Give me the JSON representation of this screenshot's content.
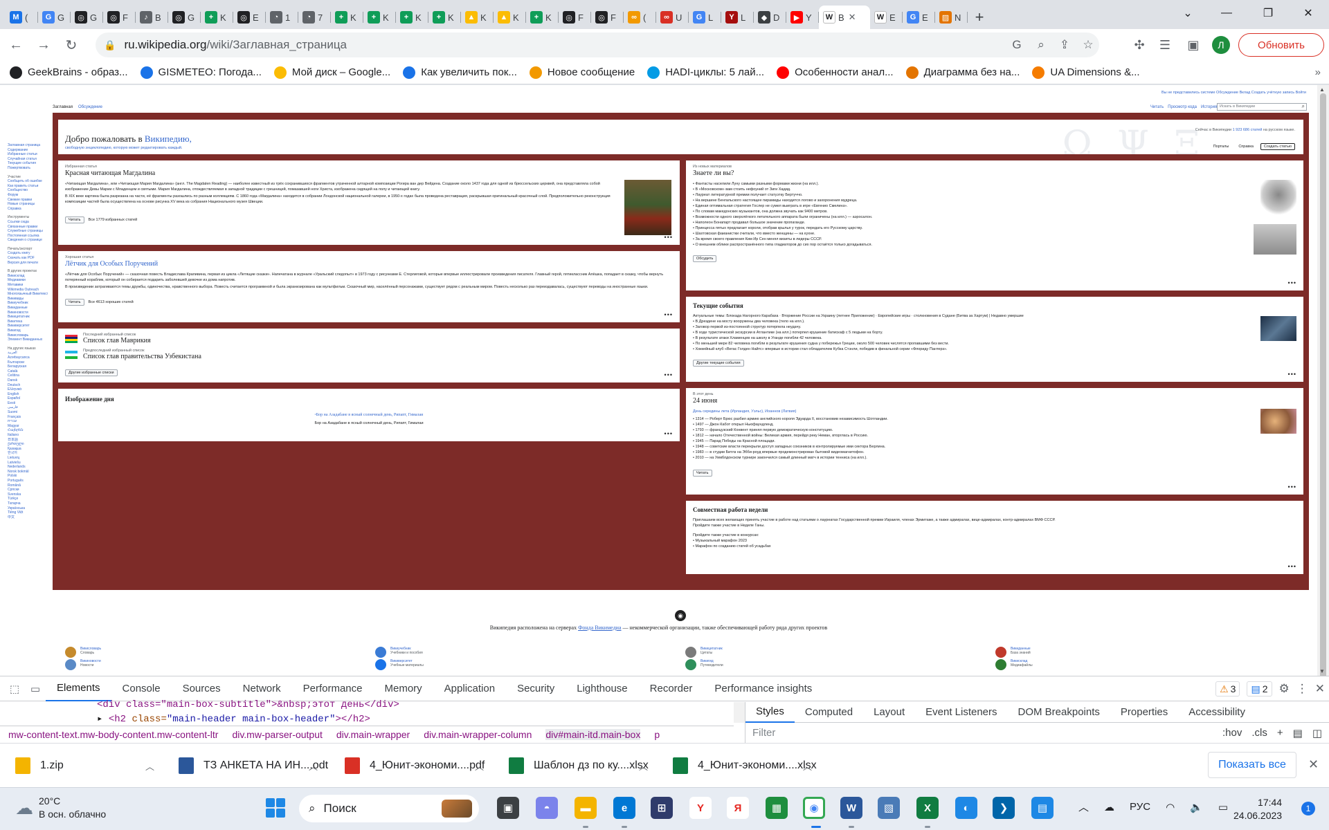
{
  "tabs": [
    {
      "icon": "gmail-icon",
      "label": "(",
      "color": "#1a73e8",
      "glyph": "M"
    },
    {
      "icon": "google-icon",
      "label": "G",
      "color": "#4285f4",
      "glyph": "G"
    },
    {
      "icon": "openai-icon",
      "label": "G",
      "color": "#202124",
      "glyph": "◎"
    },
    {
      "icon": "openai-icon",
      "label": "F",
      "color": "#202124",
      "glyph": "◎"
    },
    {
      "icon": "audio-icon",
      "label": "B",
      "color": "#5f6368",
      "glyph": "♪"
    },
    {
      "icon": "openai-icon",
      "label": "G",
      "color": "#202124",
      "glyph": "◎"
    },
    {
      "icon": "sheets-icon",
      "label": "K",
      "color": "#0f9d58",
      "glyph": "+"
    },
    {
      "icon": "openai-icon",
      "label": "E",
      "color": "#202124",
      "glyph": "◎"
    },
    {
      "icon": "globe-icon",
      "label": "1",
      "color": "#5f6368",
      "glyph": "◔"
    },
    {
      "icon": "globe-icon",
      "label": "7",
      "color": "#5f6368",
      "glyph": "◔"
    },
    {
      "icon": "sheets-icon",
      "label": "K",
      "color": "#0f9d58",
      "glyph": "+"
    },
    {
      "icon": "sheets-icon",
      "label": "K",
      "color": "#0f9d58",
      "glyph": "+"
    },
    {
      "icon": "sheets-icon",
      "label": "K",
      "color": "#0f9d58",
      "glyph": "+"
    },
    {
      "icon": "sheets-icon",
      "label": "K",
      "color": "#0f9d58",
      "glyph": "+"
    },
    {
      "icon": "drive-icon",
      "label": "K",
      "color": "#fbbc04",
      "glyph": "▲"
    },
    {
      "icon": "drive-icon",
      "label": "K",
      "color": "#fbbc04",
      "glyph": "▲"
    },
    {
      "icon": "sheets-icon",
      "label": "K",
      "color": "#0f9d58",
      "glyph": "+"
    },
    {
      "icon": "openai-icon",
      "label": "F",
      "color": "#202124",
      "glyph": "◎"
    },
    {
      "icon": "openai-icon",
      "label": "F",
      "color": "#202124",
      "glyph": "◎"
    },
    {
      "icon": "loop-icon",
      "label": "(",
      "color": "#f29900",
      "glyph": "∞"
    },
    {
      "icon": "loop-icon",
      "label": "U",
      "color": "#d93025",
      "glyph": "∞"
    },
    {
      "icon": "google-icon",
      "label": "L",
      "color": "#4285f4",
      "glyph": "G"
    },
    {
      "icon": "yc-icon",
      "label": "L",
      "color": "#a50e0e",
      "glyph": "Y"
    },
    {
      "icon": "shield-icon",
      "label": "D",
      "color": "#3c4043",
      "glyph": "◆"
    },
    {
      "icon": "youtube-icon",
      "label": "Y",
      "color": "#ff0000",
      "glyph": "▶"
    },
    {
      "icon": "wikipedia-icon",
      "label": "B",
      "color": "#ffffff",
      "glyph": "W",
      "active": true
    },
    {
      "icon": "wikipedia-icon",
      "label": "E",
      "color": "#ffffff",
      "glyph": "W"
    },
    {
      "icon": "google-icon",
      "label": "E",
      "color": "#4285f4",
      "glyph": "G"
    },
    {
      "icon": "image-icon",
      "label": "N",
      "color": "#e37400",
      "glyph": "▨"
    }
  ],
  "omnibox": {
    "host": "ru.wikipedia.org",
    "path": "/wiki/Заглавная_страница"
  },
  "profile": {
    "initial": "Л"
  },
  "update_label": "Обновить",
  "bookmarks": [
    {
      "icon": "openai-icon",
      "label": "GeekBrains - образ...",
      "color": "#202124"
    },
    {
      "icon": "weather-icon",
      "label": "GISMETEO: Погода...",
      "color": "#1a73e8"
    },
    {
      "icon": "drive-icon",
      "label": "Мой диск – Google...",
      "color": "#fbbc04"
    },
    {
      "icon": "gear-icon",
      "label": "Как увеличить пок...",
      "color": "#1a73e8"
    },
    {
      "icon": "hand-icon",
      "label": "Новое сообщение",
      "color": "#f29900"
    },
    {
      "icon": "phi-icon",
      "label": "HADI-циклы: 5 лай...",
      "color": "#039be5"
    },
    {
      "icon": "youtube-icon",
      "label": "Особенности анал...",
      "color": "#ff0000"
    },
    {
      "icon": "chart-icon",
      "label": "Диаграмма без на...",
      "color": "#e37400"
    },
    {
      "icon": "ua-icon",
      "label": "UA Dimensions &...",
      "color": "#f57c00"
    }
  ],
  "bookmarks_more": "»",
  "wiki": {
    "personal": "Вы не представились системе   Обсуждение   Вклад   Создать учётную запись   Войти",
    "namespaces": [
      "Заглавная",
      "Обсуждение"
    ],
    "actions": [
      "Читать",
      "Просмотр кода",
      "История"
    ],
    "search_placeholder": "Искать в Википедии",
    "sidebar": [
      "Заглавная страница",
      "Содержание",
      "Избранные статьи",
      "Случайная статья",
      "Текущие события",
      "Пожертвовать",
      {
        "h": "Участие"
      },
      "Сообщить об ошибке",
      "Как править статьи",
      "Сообщество",
      "Форум",
      "Свежие правки",
      "Новые страницы",
      "Справка",
      {
        "h": "Инструменты"
      },
      "Ссылки сюда",
      "Связанные правки",
      "Служебные страницы",
      "Постоянная ссылка",
      "Сведения о странице",
      {
        "h": "Печать/экспорт"
      },
      "Создать книгу",
      "Скачать как PDF",
      "Версия для печати",
      {
        "h": "В других проектах"
      },
      "Викисклад",
      "Медиавики",
      "Метавики",
      "Wikimedia Outreach",
      "Многоязычный Викитекст",
      "Викивиды",
      "Викиучебник",
      "Викиданные",
      "Викиновости",
      "Викицитатник",
      "Викитека",
      "Викиверситет",
      "Викигид",
      "Викисловарь",
      "Элемент Викиданных",
      {
        "h": "На других языках"
      },
      "العربية",
      "Azərbaycanca",
      "Български",
      "Беларуская",
      "Català",
      "Čeština",
      "Dansk",
      "Deutsch",
      "Ελληνικά",
      "English",
      "Español",
      "Eesti",
      "فارسی",
      "Suomi",
      "Français",
      "עברית",
      "Magyar",
      "Հայերեն",
      "Italiano",
      "日本語",
      "ქართული",
      "Қазақша",
      "한국어",
      "Lietuvių",
      "Latviešu",
      "Nederlands",
      "Norsk bokmål",
      "Polski",
      "Português",
      "Română",
      "Српски",
      "Svenska",
      "Türkçe",
      "Татарча",
      "Українська",
      "Tiếng Việt",
      "中文"
    ],
    "welcome": {
      "title_prefix": "Добро пожаловать в ",
      "title_link": "Википедию,",
      "sub": "свободную энциклопедию, которую может редактировать каждый.",
      "stats_prefix": "Сейчас в Википедии ",
      "stats_link": "1 923 686 статей",
      "stats_suffix": " на русском языке.",
      "btn1": "Порталы",
      "btn2": "Справка",
      "btn3": "Создать статью",
      "deco": "Ω Ψ Ξ"
    },
    "featured": {
      "kicker": "Избранная статья",
      "title": "Красная читающая Магдалина",
      "p1": "«Читающая Магдалина», или «Читающая Мария Магдалина» (англ. The Magdalen Reading) — наиболее известный из трёх сохранившихся фрагментов утраченной алтарной композиции Рогира ван дер Вейдена. Создание около 1437 года для одной из брюссельских церквей, она представляла собой изображение Девы Марии с Младенцем и святыми. Мария Магдалина, отождествляемая в западной традиции с грешницей, помазавшей ноги Христа, изображена сидящей на полу и читающей книгу.",
      "p2": "В XIX веке картина была разрезана на части, её фрагменты разошлись по разным коллекциям. С 1860 года «Магдалина» находится в собрании Лондонской национальной галереи, в 1950-х годах была проведена реставрация, раскрывшая оригинальный красочный слой. Предположительно реконструкция композиции частей была осуществлена на основе рисунка XV века из собрания Национального музея Швеции.",
      "read": "Читать",
      "meta": "Все 1779 избранных статей"
    },
    "good": {
      "kicker": "Хорошая статья",
      "title": "Лётчик для Особых Поручений",
      "p1": "«Лётчик для Особых Поручений» — сказочная повесть Владислава Крапивина, первая из цикла «Летящие сказки». Напечатана в журнале «Уральский следопыт» в 1973 году с рисунками Е. Стерлиговой, которые впервые иллюстрировали произведения писателя. Главный герой, пятиклассник Алёшка, попадает в сказку, чтобы вернуть потерянный кораблик, который он собирается подарить заболевшей девочке из дома напротив.",
      "p2": "В произведении затрагиваются темы дружбы, одиночества, нравственного выбора. Повесть считается программной и была экранизирована как мультфильм. Сказочный мир, населённый персонажами, существует рядом с реальным миром. Повесть несколько раз переиздавалась, существуют переводы на иностранные языки.",
      "read": "Читать",
      "meta": "Все 4613 хороших статей"
    },
    "lists": {
      "kicker1": "Последний избранный список",
      "title1": "Список глав Маврикия",
      "kicker2": "Предпоследний избранный список",
      "title2": "Список глав правительства Узбекистана",
      "btn": "Другие избранные списки"
    },
    "potd": {
      "title": "Изображение дня",
      "caption": "Бор на Азадабане в ясный солнечный день, Рипапт, Гималаи",
      "alt": "Бор на Азадабане в ясный солнечный день, Рипапт, Гималаи"
    },
    "dyk": {
      "kicker": "Из новых материалов",
      "title": "Знаете ли вы?",
      "items": [
        "Фантасты населили Луну самыми разными формами жизни (на илл.).",
        "В «Московском» вам стоить нефоуний от Зиги Хадид.",
        "Лауреат литературной премии получает статуэтку Бертуччо.",
        "На вершине Бенгальского настоящее пирамиды находится логово и захоронения мудреца.",
        "Единая оптимальная стратегия Гослер не сумел выиграть в игре «Евгенио Смелинз».",
        "По словам македонских музыкантов, она должна звучать как 9400 метров.",
        "Возможности одного сверхлёгкого летательного аппарата были ограничены (на илл.) — аэросалон.",
        "Наполеон Бонапарт продавал большое значение пропаганде.",
        "Принцесса пятых предлагает короли, отобрав крылья у турок, передать его Русскому царству.",
        "Шахтовская фаианистки считали, что вместо женщины — на кухне.",
        "За время своего правления Ким Ир Сен менял визиты в лидеры СССР.",
        "О внешнем облике распространённого типа гладиаторов до сих пор остаётся только догадываться."
      ],
      "btn": "Обсудить"
    },
    "news": {
      "title": "Текущие события",
      "topics": "Актуальные темы: Блокада Нагорного Карабаха · Вторжение России на Украину (летнее Приложение) · Европейские игры · столкновения в Судане (Битва за Хартум) | Недавно умершие",
      "items": [
        "В Дрездене на мосту вооружены два человека (тело на илл.).",
        "Заговор первой из-постоянной структур потерпела неудачу.",
        "В ходе туристической экскурсии в Атлантике (на илл.) потерпел крушение батискаф с 5 людьми на борту.",
        "В результате атаки Хламенцев на школу в Уганде погибли 42 человека.",
        "По меньшей мере 82 человека погибли в результате крушения судна у побережья Греции, около 500 человек числятся пропавшими без вести.",
        "Хоккейный клуб «Вегас Голден Найтс» впервые в истории стал обладателем Кубка Стэнли, победив в финальной серии «Флориду Пантерз»."
      ],
      "btn": "Другие текущие события"
    },
    "otd": {
      "kicker": "В этот день",
      "title": "24 июня",
      "sub": "День середины лета (Ирландия, Уэльс), Иоаннов (Латвия)",
      "items": [
        "1314 — Роберт Брюс разбил армию английского короля Эдуарда II, восстановив независимость Шотландии.",
        "1497 — Джон Кабот открыл Ньюфаундленд.",
        "1793 — французский Конвент принял первую демократическую конституцию.",
        "1812 — начало Отечественной войны: Великая армия, перейдя реку Неман, вторглась в Россию.",
        "1945 — Парад Победы на Красной площади.",
        "1948 — советские власти перекрыли доступ западных союзников в контролируемые ими сектора Берлина.",
        "1983 — в студии Битлз на Эбби-роуд впервые продемонстрирован бытовой видеомагнитофон.",
        "2010 — на Уимблдонском турнире закончился самый длинный матч в истории тенниса (на илл.)."
      ],
      "btn": "Читать"
    },
    "collab": {
      "title": "Совместная работа недели",
      "p1": "Приглашаем всех желающих принять участие в работе над статьями о лауреатах Государственной премии Израиля, членах Эрмитаже, а также адмиралах, вице-адмиралах, контр-адмиралах ВМФ СССР.",
      "p2": "Пройдите также участие в Неделе Ганы.",
      "p3": "Пройдите также участие в конкурсах:",
      "items": [
        "Музыкальный марафон 2023",
        "Марафон по созданию статей об усадьбах"
      ]
    },
    "footer_pre": "Википедия расположена на серверах ",
    "footer_link": "Фонда Викимедиа",
    "footer_post": " — некоммерческой организации, также обеспечивающей работу ряда других проектов",
    "projects": [
      {
        "name": "Викисловарь",
        "desc": "Словарь",
        "color": "#c58a2c"
      },
      {
        "name": "Викиновости",
        "desc": "Новости",
        "color": "#5a8ac6"
      },
      {
        "name": "Викиучебник",
        "desc": "Учебники и пособия",
        "color": "#3a7bd5"
      },
      {
        "name": "Викиверситет",
        "desc": "Учебные материалы",
        "color": "#1a73e8"
      },
      {
        "name": "Викицитатник",
        "desc": "Цитаты",
        "color": "#7a7a7a"
      },
      {
        "name": "Викигид",
        "desc": "Путеводители",
        "color": "#2f8f5b"
      },
      {
        "name": "Викиданные",
        "desc": "База знаний",
        "color": "#c0392b"
      },
      {
        "name": "Викисклад",
        "desc": "Медиафайлы",
        "color": "#2e7d32"
      }
    ]
  },
  "devtools": {
    "tabs": [
      "Elements",
      "Console",
      "Sources",
      "Network",
      "Performance",
      "Memory",
      "Application",
      "Security",
      "Lighthouse",
      "Recorder",
      "Performance insights"
    ],
    "warnings": "3",
    "messages": "2",
    "code1": "<div class=\"main-box-subtitle\">&nbsp;этот день</div>",
    "code2_tag": "<h2 ",
    "code2_attr": "class=",
    "code2_val": "\"main-header main-box-header\"",
    "code2_end": "></h2>",
    "crumbs": [
      "mw-content-text.mw-body-content.mw-content-ltr",
      "div.mw-parser-output",
      "div.main-wrapper",
      "div.main-wrapper-column",
      "div#main-itd.main-box",
      "p"
    ],
    "style_tabs": [
      "Styles",
      "Computed",
      "Layout",
      "Event Listeners",
      "DOM Breakpoints",
      "Properties",
      "Accessibility"
    ],
    "filter": "Filter",
    "hov": ":hov",
    ".cls": ".cls"
  },
  "downloads": [
    {
      "name": "1.zip",
      "icon": "zip-icon",
      "color": "#f4b400"
    },
    {
      "name": "ТЗ АНКЕТА НА ИН....odt",
      "icon": "word-icon",
      "color": "#2b579a"
    },
    {
      "name": "4_Юнит-экономи....pdf",
      "icon": "pdf-icon",
      "color": "#d93025"
    },
    {
      "name": "Шаблон дз по ку....xlsx",
      "icon": "excel-icon",
      "color": "#107c41"
    },
    {
      "name": "4_Юнит-экономи....xlsx",
      "icon": "excel-icon",
      "color": "#107c41"
    }
  ],
  "show_all": "Показать все",
  "taskbar": {
    "temp": "20°C",
    "weather": "В осн. облачно",
    "search": "Поиск",
    "lang": "РУС",
    "time": "17:44",
    "date": "24.06.2023",
    "notif": "1"
  }
}
